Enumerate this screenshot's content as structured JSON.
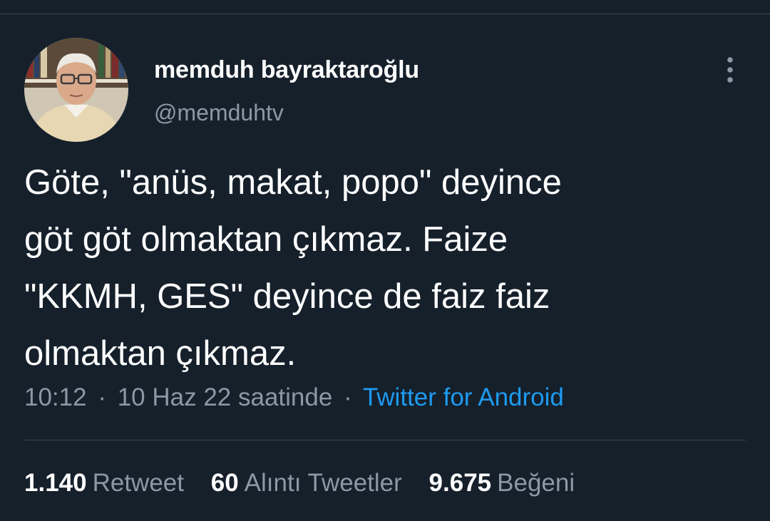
{
  "author": {
    "display_name": "memduh bayraktaroğlu",
    "handle": "@memduhtv"
  },
  "tweet": {
    "lines": [
      "Göte, \"anüs, makat, popo\" deyince",
      "göt göt olmaktan çıkmaz. Faize",
      "\"KKMH, GES\" deyince de faiz faiz",
      "olmaktan çıkmaz."
    ]
  },
  "meta": {
    "time": "10:12",
    "dot1": "·",
    "date": "10 Haz 22 saatinde",
    "dot2": "·",
    "source": "Twitter for Android"
  },
  "stats": {
    "retweets": {
      "count": "1.140",
      "label": "Retweet"
    },
    "quotes": {
      "count": "60",
      "label": "Alıntı Tweetler"
    },
    "likes": {
      "count": "9.675",
      "label": "Beğeni"
    }
  },
  "icons": {
    "more": "vertical-ellipsis-icon"
  },
  "colors": {
    "background": "#15202b",
    "primary_text": "#ffffff",
    "secondary_text": "#8b98a5",
    "link": "#1d9bf0",
    "divider": "#38444d"
  }
}
